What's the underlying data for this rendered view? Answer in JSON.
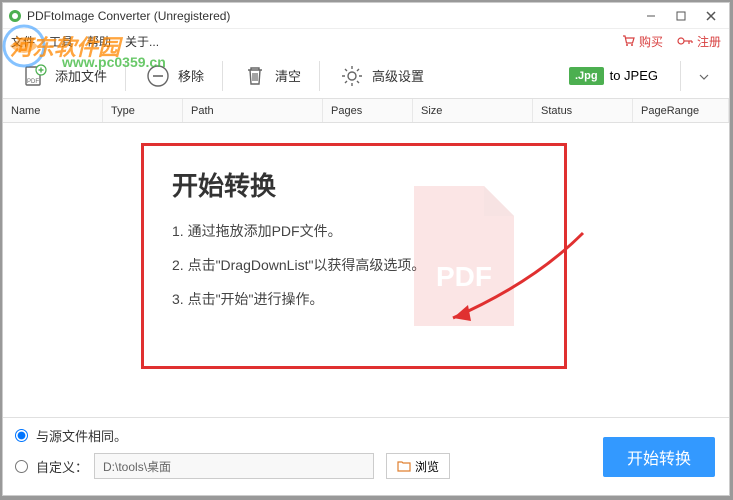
{
  "titlebar": {
    "title": "PDFtoImage Converter (Unregistered)"
  },
  "menubar": {
    "file": "文件",
    "tools": "工具",
    "help": "帮助",
    "about": "关于...",
    "buy": "购买",
    "register": "注册"
  },
  "toolbar": {
    "add_file": "添加文件",
    "remove": "移除",
    "clear": "清空",
    "advanced": "高级设置",
    "format_badge": ".Jpg",
    "format_label": "to JPEG"
  },
  "table": {
    "headers": [
      "Name",
      "Type",
      "Path",
      "Pages",
      "Size",
      "Status",
      "PageRange"
    ]
  },
  "instructions": {
    "title": "开始转换",
    "line1": "1. 通过拖放添加PDF文件。",
    "line2": "2. 点击\"DragDownList\"以获得高级选项。",
    "line3": "3. 点击\"开始\"进行操作。"
  },
  "bottom": {
    "same_as_source": "与源文件相同。",
    "custom": "自定义：",
    "path": "D:\\tools\\桌面",
    "browse": "浏览",
    "convert": "开始转换"
  },
  "watermark": {
    "text1": "河东软件园",
    "text2": "www.pc0359.cn"
  }
}
